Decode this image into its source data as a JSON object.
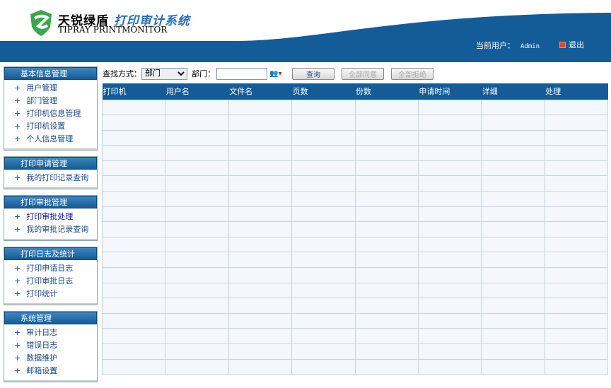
{
  "header": {
    "title_cn_brand": "天锐绿盾",
    "title_cn_system": "打印审计系统",
    "title_en": "TIPRAY PRINTMONITOR",
    "current_user_label": "当前用户：",
    "current_user": "Admin",
    "logout": "退出"
  },
  "sidebar": [
    {
      "title": "基本信息管理",
      "items": [
        "用户管理",
        "部门管理",
        "打印机信息管理",
        "打印机设置",
        "个人信息管理"
      ]
    },
    {
      "title": "打印申请管理",
      "items": [
        "我的打印记录查询"
      ]
    },
    {
      "title": "打印审批管理",
      "items": [
        "打印审批处理",
        "我的审批记录查询"
      ]
    },
    {
      "title": "打印日志及统计",
      "items": [
        "打印申请日志",
        "打印审批日志",
        "打印统计"
      ]
    },
    {
      "title": "系统管理",
      "items": [
        "审计日志",
        "错误日志",
        "数据维护",
        "邮箱设置"
      ]
    }
  ],
  "toolbar": {
    "search_label": "查找方式：",
    "search_value": "部门",
    "dept_label": "部门：",
    "dept_value": "",
    "query": "查询",
    "approve_all": "全部同意",
    "reject_all": "全部拒绝"
  },
  "table": {
    "columns": [
      "打印机",
      "用户名",
      "文件名",
      "页数",
      "份数",
      "申请时间",
      "详细",
      "处理"
    ],
    "empty_rows": 18
  }
}
